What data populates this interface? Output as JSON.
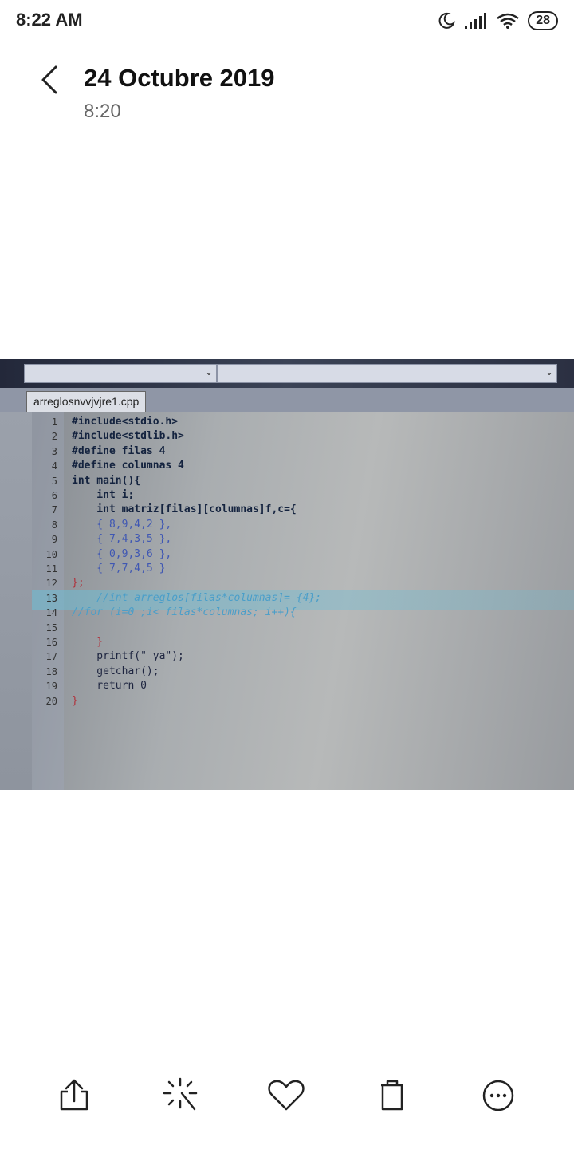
{
  "status_bar": {
    "time": "8:22 AM",
    "battery": "28"
  },
  "header": {
    "title": "24 Octubre 2019",
    "subtitle": "8:20"
  },
  "photo": {
    "file_tab": "arreglosnvvjvjre1.cpp",
    "code_lines": [
      {
        "n": "1",
        "text": "#include<stdio.h>"
      },
      {
        "n": "2",
        "text": "#include<stdlib.h>"
      },
      {
        "n": "3",
        "text": "#define filas 4"
      },
      {
        "n": "4",
        "text": "#define columnas 4"
      },
      {
        "n": "5",
        "text": "int main(){"
      },
      {
        "n": "6",
        "text": "    int i;"
      },
      {
        "n": "7",
        "text": "    int matriz[filas][columnas]f,c={"
      },
      {
        "n": "8",
        "text": "    { 8,9,4,2 },"
      },
      {
        "n": "9",
        "text": "    { 7,4,3,5 },"
      },
      {
        "n": "10",
        "text": "    { 0,9,3,6 },"
      },
      {
        "n": "11",
        "text": "    { 7,7,4,5 }"
      },
      {
        "n": "12",
        "text": "};"
      },
      {
        "n": "13",
        "text": "    //int arreglos[filas*columnas]= {4};"
      },
      {
        "n": "14",
        "text": "//for (i=0 ;i< filas*columnas; i++){"
      },
      {
        "n": "15",
        "text": ""
      },
      {
        "n": "16",
        "text": "    }"
      },
      {
        "n": "17",
        "text": "    printf(\" ya\");"
      },
      {
        "n": "18",
        "text": "    getchar();"
      },
      {
        "n": "19",
        "text": "    return 0"
      },
      {
        "n": "20",
        "text": "}"
      }
    ]
  },
  "toolbar": {
    "share": "share-icon",
    "edit": "magic-wand-icon",
    "favorite": "heart-icon",
    "delete": "trash-icon",
    "more": "more-icon"
  }
}
